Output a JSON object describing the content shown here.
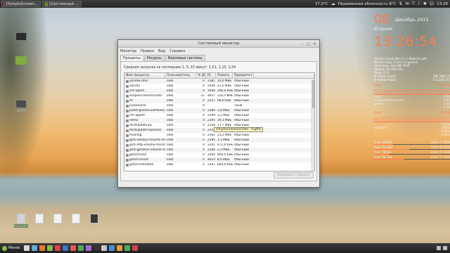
{
  "top_panel": {
    "tasks": [
      {
        "label": "[SimpleScreen..."
      },
      {
        "label": "[Системный ..."
      }
    ],
    "temperature": "37,0°C",
    "weather": "Переменная облачность 8°C",
    "time": "13:26"
  },
  "desktop": {
    "icons": [
      {
        "label": ""
      },
      {
        "label": ""
      },
      {
        "label": "DATA1"
      }
    ],
    "bottom_icons": [
      {
        "label": "Корзина"
      },
      {
        "label": "..."
      },
      {
        "label": "..."
      },
      {
        "label": "..."
      },
      {
        "label": "..."
      }
    ]
  },
  "conky": {
    "day": "08",
    "month_year": "Декабрь 2015",
    "weekday": "Вторник",
    "time": "13:26:54",
    "info": [
      {
        "label": "Version: Linux Mint 17.1 Rebecca x86",
        "value": ""
      },
      {
        "label": "Kernel: Linux 3.13.0-37-generic",
        "value": ""
      },
      {
        "label": "Hostname: oleb-MS-7636",
        "value": ""
      },
      {
        "label": "Uptime: 0h 49m 28s",
        "value": ""
      },
      {
        "label": "Temp: 0 °C",
        "value": ""
      },
      {
        "label": "IP adress Local:",
        "value": "192.168.1.2"
      },
      {
        "label": "IP adress Public:",
        "value": "5.3.228.177"
      }
    ],
    "cpu_section": {
      "label": "CPU",
      "value": "26.0%"
    },
    "cpu_procs": [
      {
        "name": "Xorg",
        "value": "6.00"
      },
      {
        "name": "simplescreenrecorder",
        "value": "4.00"
      },
      {
        "name": "gnome-...",
        "value": "2.20"
      },
      {
        "name": "...",
        "value": "1.20"
      }
    ],
    "ram_section": {
      "label": "RAM",
      "value": "32.3%"
    },
    "ram_procs": [
      {
        "name": "...",
        "value": "4.11%"
      },
      {
        "name": "unknown",
        "value": "3.91%"
      },
      {
        "name": "...",
        "value": "2.68%"
      },
      {
        "name": "...",
        "value": "1.82%"
      }
    ],
    "fs": [
      {
        "label": "Free: 19.0GB",
        "value": "Used: 5.79GB",
        "fill": 0.25
      },
      {
        "label": "Free: 76.2GB",
        "value": "Used: 65.3GB",
        "fill": 0.46
      },
      {
        "label": "Free: 190GB",
        "value": "Used: 43.8GB",
        "fill": 0.19
      },
      {
        "label": "Free: 86.2GB",
        "value": "Used: 57.0GB",
        "fill": 0.4
      }
    ]
  },
  "window": {
    "title": "Системный монитор",
    "menu": [
      "Монитор",
      "Правка",
      "Вид",
      "Справка"
    ],
    "tabs": [
      "Процессы",
      "Ресурсы",
      "Файловые системы"
    ],
    "load": "Средняя загрузка за последние 1, 5, 15 минут: 1,51, 1,10, 1,54",
    "columns": [
      "Имя процесса",
      "Пользователь",
      "% ЦП",
      "ID",
      "Память",
      "Приоритет"
    ],
    "rows": [
      {
        "name": "yandex-disk",
        "user": "oleb",
        "cpu": "0",
        "id": "2381",
        "mem": "10,0 МиБ",
        "pri": "Обычный"
      },
      {
        "name": "variety",
        "user": "oleb",
        "cpu": "0",
        "id": "2426",
        "mem": "21,0 МиБ",
        "pri": "Обычный"
      },
      {
        "name": "ssh-agent",
        "user": "oleb",
        "cpu": "0",
        "id": "1946",
        "mem": "200,0 КиБ",
        "pri": "Обычный"
      },
      {
        "name": "simplescreenrecorder",
        "user": "oleb",
        "cpu": "25",
        "id": "4857",
        "mem": "226,5 МиБ",
        "pri": "Обычный"
      },
      {
        "name": "sh",
        "user": "oleb",
        "cpu": "0",
        "id": "2357",
        "mem": "68,0 КиБ",
        "pri": "Обычный"
      },
      {
        "name": "pulseaudio",
        "user": "oleb",
        "cpu": "0",
        "id": "",
        "mem": "",
        "pri": "чный"
      },
      {
        "name": "polkit-gnome-authentication-ag",
        "user": "oleb",
        "cpu": "0",
        "id": "2284",
        "mem": "1,8 МиБ",
        "pri": "Обычный"
      },
      {
        "name": "nm-applet",
        "user": "oleb",
        "cpu": "0",
        "id": "2299",
        "mem": "3,2 МиБ",
        "pri": "Обычный"
      },
      {
        "name": "nemo",
        "user": "oleb",
        "cpu": "0",
        "id": "2295",
        "mem": "29,3 МиБ",
        "pri": "Обычный"
      },
      {
        "name": "mintUpdate.py",
        "user": "oleb",
        "cpu": "0",
        "id": "2358",
        "mem": "11,7 МиБ",
        "pri": "Обычный"
      },
      {
        "name": "mintUpdate-launcher",
        "user": "oleb",
        "cpu": "0",
        "id": "2354",
        "mem": "1,6 МиБ",
        "pri": "Обычный"
      },
      {
        "name": "mailnag",
        "user": "oleb",
        "cpu": "0",
        "id": "2301",
        "mem": "23,2 МиБ",
        "pri": "Обычный"
      },
      {
        "name": "gvfs-udisks2-volume-monitor",
        "user": "oleb",
        "cpu": "0",
        "id": "2185",
        "mem": "1,5 МиБ",
        "pri": "Обычный"
      },
      {
        "name": "gvfs-mtp-volume-monitor",
        "user": "oleb",
        "cpu": "0",
        "id": "2201",
        "mem": "472,0 КиБ",
        "pri": "Обычный"
      },
      {
        "name": "gvfs-gphoto2-volume-monitor",
        "user": "oleb",
        "cpu": "0",
        "id": "2206",
        "mem": "2,3 МиБ",
        "pri": "Обычный"
      },
      {
        "name": "gvfsd-trash",
        "user": "oleb",
        "cpu": "0",
        "id": "2446",
        "mem": "844,0 КиБ",
        "pri": "Обычный"
      },
      {
        "name": "gvfsd-recent",
        "user": "oleb",
        "cpu": "0",
        "id": "4614",
        "mem": "8,0 МиБ",
        "pri": "Обычный"
      },
      {
        "name": "gvfsd-metadata",
        "user": "oleb",
        "cpu": "0",
        "id": "2341",
        "mem": "804,0 КиБ",
        "pri": "Обычный"
      }
    ],
    "tooltip": "simplescreenrecorder --logfile",
    "end_button": "Завершить процесс"
  },
  "taskbar": {
    "menu_label": "Меню",
    "icon_colors": [
      "#d9d9d9",
      "#6aa9e0",
      "#e27b2b",
      "#8bb84a",
      "#d44",
      "#3a78c8",
      "#e05a5a",
      "#58a45a",
      "#9c6dd0",
      "#333",
      "#c8c8c8",
      "#4a90d9",
      "#e8a03a",
      "#55aa55",
      "#cc4444"
    ]
  },
  "colors": {
    "accent": "#ff7b52",
    "panel": "#2b2b2b"
  }
}
